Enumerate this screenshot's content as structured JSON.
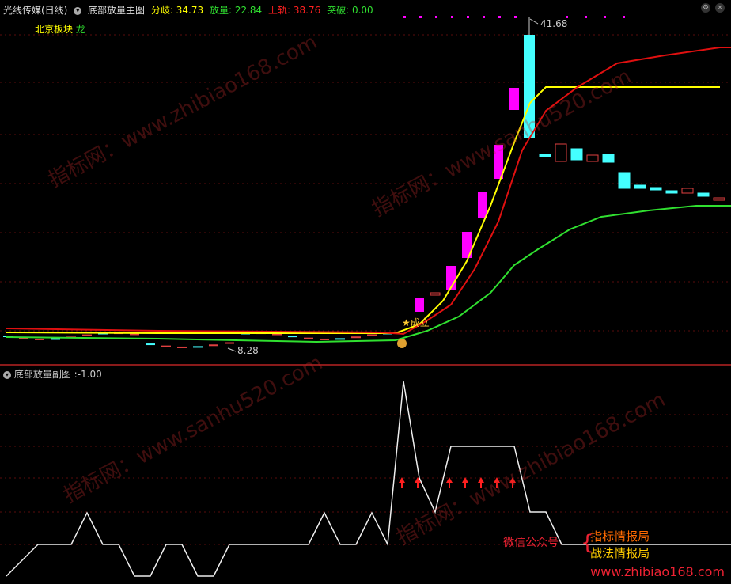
{
  "header": {
    "stock_name": "光线传媒(日线)",
    "indicator_name": "底部放量主图",
    "fenqi_label": "分歧",
    "fenqi_value": "34.73",
    "fangliang_label": "放量",
    "fangliang_value": "22.84",
    "shanggui_label": "上轨",
    "shanggui_value": "38.76",
    "tupo_label": "突破",
    "tupo_value": "0.00"
  },
  "sector": {
    "name": "北京板块",
    "tag": "龙"
  },
  "annotations": {
    "high_price": "41.68",
    "low_price": "8.28",
    "signal_text": "成立"
  },
  "sub_header": {
    "name": "底部放量副图",
    "value": "-1.00"
  },
  "watermarks": [
    "指标网：www.zhibiao168.com",
    "指标网：www.sanhu520.com"
  ],
  "promo": {
    "label": "微信公众号",
    "line1": "指标情报局",
    "line2": "战法情报局",
    "site": "www.zhibiao168.com"
  },
  "colors": {
    "bull": "#ff00ff",
    "bear": "#4ff",
    "yellow_line": "#ffff00",
    "red_line": "#e01010",
    "green_line": "#30e030"
  }
}
